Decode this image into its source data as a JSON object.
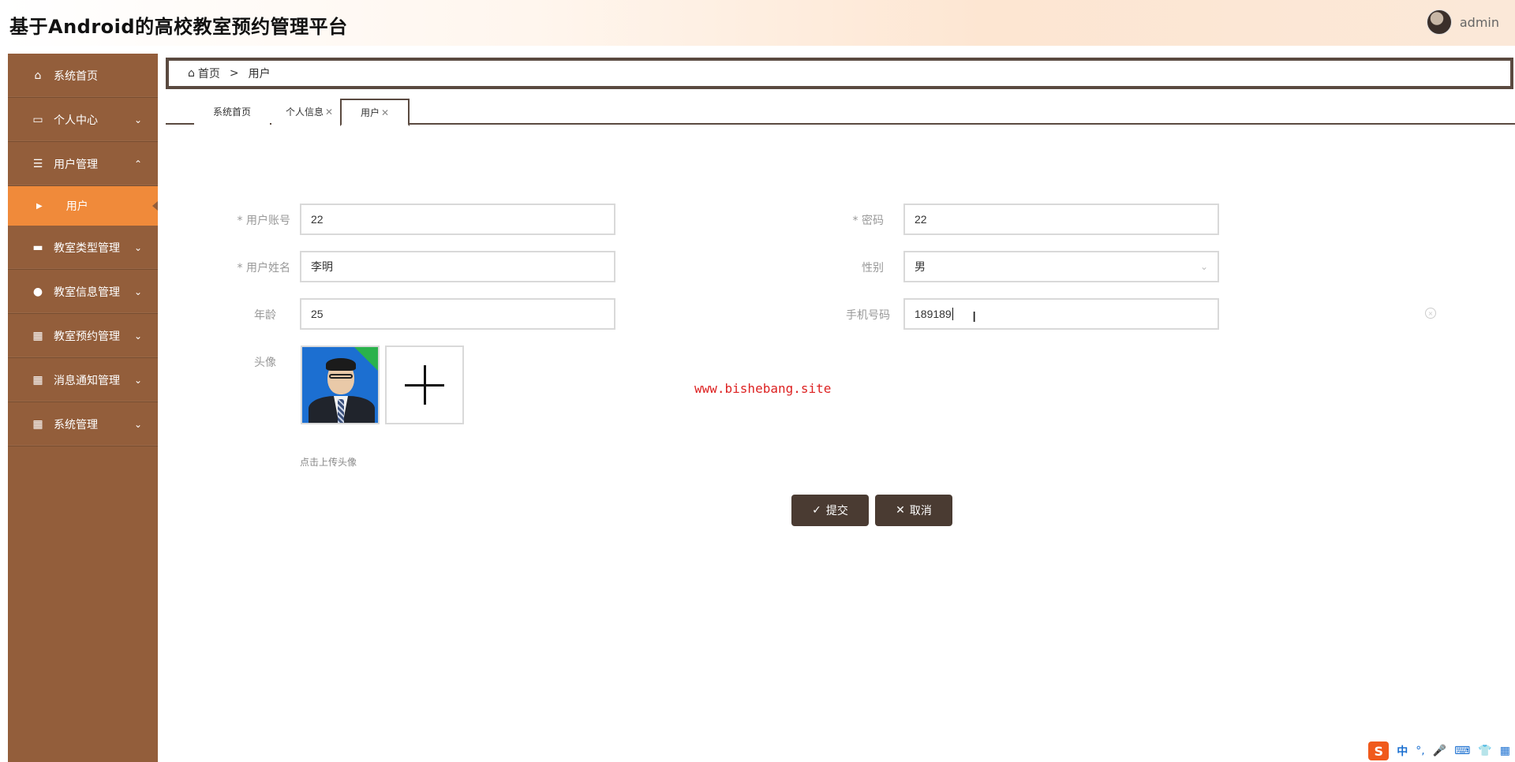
{
  "header": {
    "title": "基于Android的高校教室预约管理平台",
    "username": "admin"
  },
  "sidebar": {
    "items": [
      {
        "label": "系统首页",
        "icon": "home-icon"
      },
      {
        "label": "个人中心",
        "icon": "card-icon"
      },
      {
        "label": "用户管理",
        "icon": "list-icon"
      },
      {
        "label": "用户",
        "icon": "caret-right-icon"
      },
      {
        "label": "教室类型管理",
        "icon": "briefcase-icon"
      },
      {
        "label": "教室信息管理",
        "icon": "bulb-icon"
      },
      {
        "label": "教室预约管理",
        "icon": "grid-icon"
      },
      {
        "label": "消息通知管理",
        "icon": "grid-icon"
      },
      {
        "label": "系统管理",
        "icon": "grid-icon"
      }
    ]
  },
  "breadcrumb": {
    "home": "首页",
    "separator": ">",
    "current": "用户"
  },
  "tabs": [
    {
      "label": "系统首页"
    },
    {
      "label": "个人信息"
    },
    {
      "label": "用户"
    }
  ],
  "form": {
    "account": {
      "label": "用户账号",
      "value": "22"
    },
    "password": {
      "label": "密码",
      "value": "22"
    },
    "name": {
      "label": "用户姓名",
      "value": "李明"
    },
    "gender": {
      "label": "性别",
      "value": "男"
    },
    "age": {
      "label": "年龄",
      "value": "25"
    },
    "phone": {
      "label": "手机号码",
      "value": "189189"
    },
    "avatar": {
      "label": "头像",
      "hint": "点击上传头像"
    },
    "required_mark": "*"
  },
  "watermark": "www.bishebang.site",
  "actions": {
    "submit": "提交",
    "cancel": "取消"
  },
  "ime": {
    "lang": "中",
    "punct": "°,"
  },
  "colors": {
    "sidebar": "#935e3b",
    "sidebar_active": "#f08a3a",
    "button": "#4a3b32",
    "watermark": "#dd2222"
  }
}
